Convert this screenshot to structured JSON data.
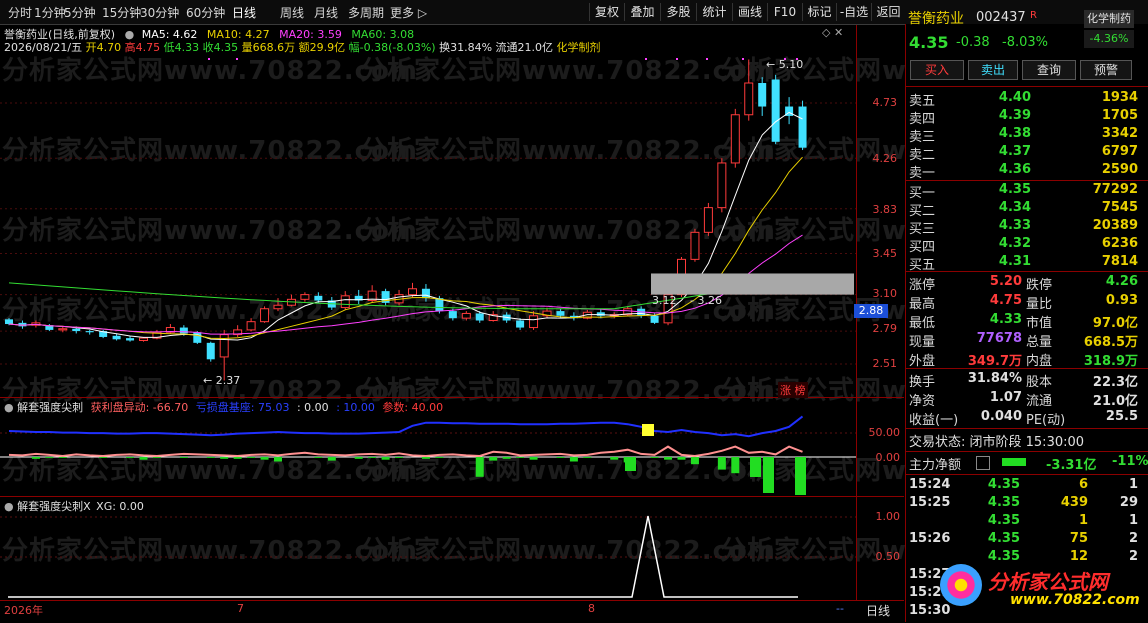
{
  "toolbar": {
    "left_items": [
      "分时",
      "1分钟",
      "5分钟",
      "15分钟",
      "30分钟",
      "60分钟",
      "日线",
      "周线",
      "月线",
      "多周期",
      "更多 ▷"
    ],
    "right_items": [
      "复权",
      "叠加",
      "多股",
      "统计",
      "画线",
      "F10",
      "标记",
      "-自选",
      "返回"
    ]
  },
  "header": {
    "stock_title": "誉衡药业(日线,前复权)",
    "ma5": "MA5: 4.62",
    "ma10": "MA10: 4.27",
    "ma20": "MA20: 3.59",
    "ma60": "MA60: 3.08",
    "date": "2026/08/21/五",
    "open": "开4.70",
    "high": "高4.75",
    "low": "低4.33",
    "close": "收4.35",
    "volume": "量668.6万",
    "amount": "额29.9亿",
    "change": "幅-0.38(-8.03%)",
    "turnover": "换31.84%",
    "float": "流通21.0亿",
    "sector": "化学制剂"
  },
  "main_chart": {
    "y_ticks": [
      "4.73",
      "4.26",
      "3.83",
      "3.45",
      "3.10",
      "2.79",
      "2.51"
    ],
    "current_price_tag": "2.88",
    "annotation_high": "5.10",
    "annotation_low": "2.37",
    "annotation_mid": "3.12",
    "annotation_mid2": "3.26",
    "badge": "涨 榜"
  },
  "indicator1": {
    "name": "解套强度尖刺",
    "profit_label": "获利盘异动: -66.70",
    "loss_label": "亏损盘基座: 75.03",
    "zero_label": ": 0.00",
    "ten_label": ": 10.00",
    "param_label": "参数: 40.00",
    "y_ticks": [
      "50.00",
      "0.00"
    ]
  },
  "indicator2": {
    "name": "解套强度尖刺X",
    "xg_label": "XG: 0.00",
    "y_ticks": [
      "1.00",
      "0.50"
    ]
  },
  "x_axis": {
    "labels": [
      "2026年",
      "7",
      "8"
    ],
    "period": "日线",
    "zoom_btn": "--"
  },
  "right_panel": {
    "name": "誉衡药业",
    "code": "002437",
    "flag": "R",
    "tag": "化学制药",
    "tag_change": "-4.36%",
    "price": "4.35",
    "change": "-0.38",
    "change_pct": "-8.03%",
    "buttons": [
      "买入",
      "卖出",
      "查询",
      "预警"
    ],
    "asks": [
      {
        "label": "卖五",
        "price": "4.40",
        "vol": "1934"
      },
      {
        "label": "卖四",
        "price": "4.39",
        "vol": "1705"
      },
      {
        "label": "卖三",
        "price": "4.38",
        "vol": "3342"
      },
      {
        "label": "卖二",
        "price": "4.37",
        "vol": "6797"
      },
      {
        "label": "卖一",
        "price": "4.36",
        "vol": "2590"
      }
    ],
    "bids": [
      {
        "label": "买一",
        "price": "4.35",
        "vol": "77292"
      },
      {
        "label": "买二",
        "price": "4.34",
        "vol": "7545"
      },
      {
        "label": "买三",
        "price": "4.33",
        "vol": "20389"
      },
      {
        "label": "买四",
        "price": "4.32",
        "vol": "6236"
      },
      {
        "label": "买五",
        "price": "4.31",
        "vol": "7814"
      }
    ],
    "stats": [
      {
        "l1": "涨停",
        "v1": "5.20",
        "l2": "跌停",
        "v2": "4.26"
      },
      {
        "l1": "最高",
        "v1": "4.75",
        "l2": "量比",
        "v2": "0.93"
      },
      {
        "l1": "最低",
        "v1": "4.33",
        "l2": "市值",
        "v2": "97.0亿"
      },
      {
        "l1": "现量",
        "v1": "77678",
        "l2": "总量",
        "v2": "668.5万"
      },
      {
        "l1": "外盘",
        "v1": "349.7万",
        "l2": "内盘",
        "v2": "318.9万"
      }
    ],
    "stats2": [
      {
        "l1": "换手",
        "v1": "31.84%",
        "l2": "股本",
        "v2": "22.3亿"
      },
      {
        "l1": "净资",
        "v1": "1.07",
        "l2": "流通",
        "v2": "21.0亿"
      },
      {
        "l1": "收益(一)",
        "v1": "0.040",
        "l2": "PE(动)",
        "v2": "25.5"
      }
    ],
    "trade_status": "交易状态: 闭市阶段 15:30:00",
    "main_flow_label": "主力净额",
    "main_flow_value": "-3.31亿",
    "main_flow_pct": "-11%",
    "ticks": [
      {
        "time": "15:24",
        "price": "4.35",
        "vol": "6",
        "n": "1"
      },
      {
        "time": "15:25",
        "price": "4.35",
        "vol": "439",
        "n": "29"
      },
      {
        "time": "",
        "price": "4.35",
        "vol": "1",
        "n": "1"
      },
      {
        "time": "15:26",
        "price": "4.35",
        "vol": "75",
        "n": "2"
      },
      {
        "time": "",
        "price": "4.35",
        "vol": "12",
        "n": "2"
      },
      {
        "time": "15:27",
        "price": "",
        "vol": "",
        "n": ""
      },
      {
        "time": "15:29",
        "price": "",
        "vol": "",
        "n": ""
      },
      {
        "time": "15:30",
        "price": "",
        "vol": "",
        "n": ""
      }
    ],
    "logo_text": "分析家公式网",
    "logo_url": "www.70822.com"
  },
  "watermark": {
    "text": "分析家公式网www.70822.com"
  },
  "colors": {
    "up": "#ff3b3b",
    "down": "#40e0ff",
    "ma5": "#ffffff",
    "ma10": "#e8d000",
    "ma20": "#ff40ff",
    "ma60": "#33dd33"
  }
}
